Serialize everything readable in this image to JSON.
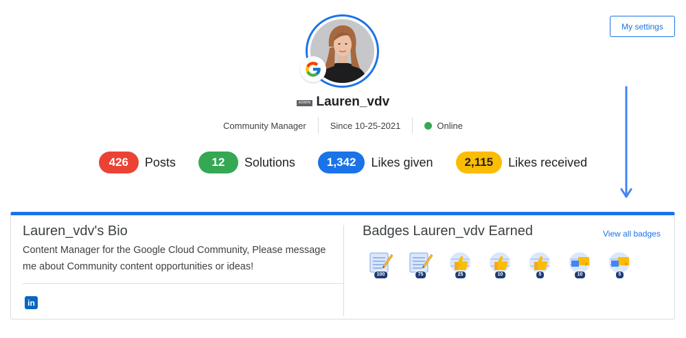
{
  "header": {
    "settings_label": "My settings"
  },
  "profile": {
    "admin_tag": "ADMIN",
    "username": "Lauren_vdv",
    "role": "Community Manager",
    "since_label": "Since ",
    "since_date": "10-25-2021",
    "status": "Online"
  },
  "stats": [
    {
      "value": "426",
      "label": "Posts",
      "color": "#ea4335"
    },
    {
      "value": "12",
      "label": "Solutions",
      "color": "#34a853"
    },
    {
      "value": "1,342",
      "label": "Likes given",
      "color": "#1a73e8"
    },
    {
      "value": "2,115",
      "label": "Likes received",
      "color": "#fbbc04"
    }
  ],
  "bio": {
    "title": "Lauren_vdv's Bio",
    "text": "Content Manager for the Google Cloud Community, Please message me about Community content opportunities or ideas!",
    "social_icon": "linkedin-icon",
    "social_letter": "in"
  },
  "badges": {
    "title": "Badges Lauren_vdv Earned",
    "view_all_label": "View all badges",
    "items": [
      {
        "type": "post",
        "count": "100"
      },
      {
        "type": "post",
        "count": "75"
      },
      {
        "type": "like",
        "count": "25"
      },
      {
        "type": "like",
        "count": "10"
      },
      {
        "type": "like",
        "count": "5"
      },
      {
        "type": "solution",
        "count": "10"
      },
      {
        "type": "solution",
        "count": "5"
      }
    ]
  },
  "colors": {
    "accent": "#1a73e8",
    "online": "#34a853"
  }
}
